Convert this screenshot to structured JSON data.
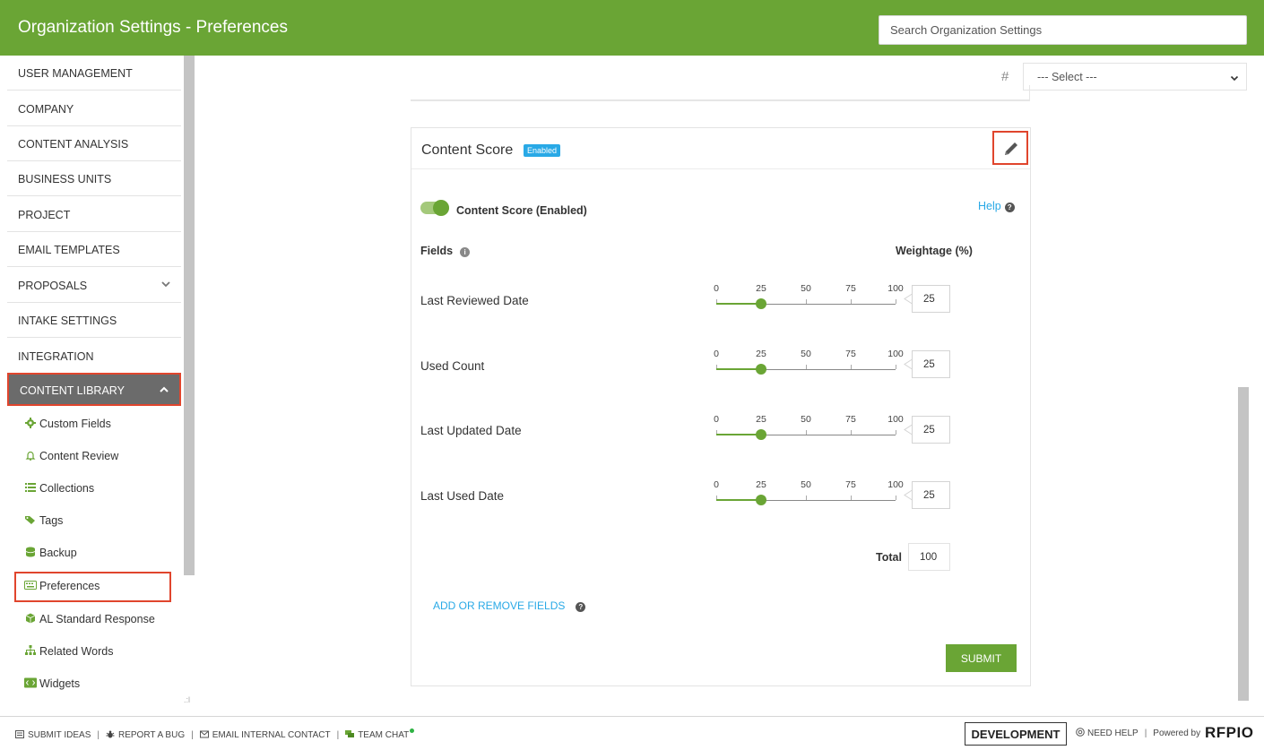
{
  "header": {
    "title": "Organization Settings - Preferences",
    "search_placeholder": "Search Organization Settings",
    "bg_color": "#6aa535"
  },
  "sidebar": {
    "items": [
      {
        "label": "USER MANAGEMENT"
      },
      {
        "label": "COMPANY"
      },
      {
        "label": "CONTENT ANALYSIS"
      },
      {
        "label": "BUSINESS UNITS"
      },
      {
        "label": "PROJECT"
      },
      {
        "label": "EMAIL TEMPLATES"
      },
      {
        "label": "PROPOSALS",
        "expandable": true
      },
      {
        "label": "INTAKE SETTINGS"
      },
      {
        "label": "INTEGRATION"
      },
      {
        "label": "CONTENT LIBRARY",
        "expanded": true,
        "active": true
      }
    ],
    "sub_items": [
      {
        "label": "Custom Fields",
        "icon": "gear-icon"
      },
      {
        "label": "Content Review",
        "icon": "bell-icon"
      },
      {
        "label": "Collections",
        "icon": "list-icon"
      },
      {
        "label": "Tags",
        "icon": "tags-icon"
      },
      {
        "label": "Backup",
        "icon": "database-icon"
      },
      {
        "label": "Preferences",
        "icon": "keyboard-icon",
        "active": true
      },
      {
        "label": "AL Standard Response",
        "icon": "cube-icon"
      },
      {
        "label": "Related Words",
        "icon": "sitemap-icon"
      },
      {
        "label": "Widgets",
        "icon": "code-icon"
      }
    ]
  },
  "toolbar": {
    "hash_symbol": "#",
    "select_value": "--- Select ---"
  },
  "card": {
    "title": "Content Score",
    "badge": "Enabled",
    "toggle_label": "Content Score (Enabled)",
    "toggle_on": true,
    "help_label": "Help",
    "fields_label": "Fields",
    "weightage_label": "Weightage (%)",
    "tick_labels": [
      "0",
      "25",
      "50",
      "75",
      "100"
    ],
    "rows": [
      {
        "label": "Last Reviewed Date",
        "value": "25",
        "slider": 25
      },
      {
        "label": "Used Count",
        "value": "25",
        "slider": 25
      },
      {
        "label": "Last Updated Date",
        "value": "25",
        "slider": 25
      },
      {
        "label": "Last Used Date",
        "value": "25",
        "slider": 25
      }
    ],
    "total_label": "Total",
    "total_value": "100",
    "add_fields_label": "ADD OR REMOVE FIELDS",
    "submit_label": "SUBMIT"
  },
  "footer": {
    "submit_ideas": "SUBMIT IDEAS",
    "report_bug": "REPORT A BUG",
    "email_contact": "EMAIL INTERNAL CONTACT",
    "team_chat": "TEAM CHAT",
    "environment": "DEVELOPMENT",
    "need_help": "NEED HELP",
    "powered_by": "Powered by",
    "brand": "RFPIO"
  },
  "colors": {
    "accent_green": "#6aa535",
    "link_blue": "#29a9e6",
    "highlight_red": "#e0452d"
  }
}
